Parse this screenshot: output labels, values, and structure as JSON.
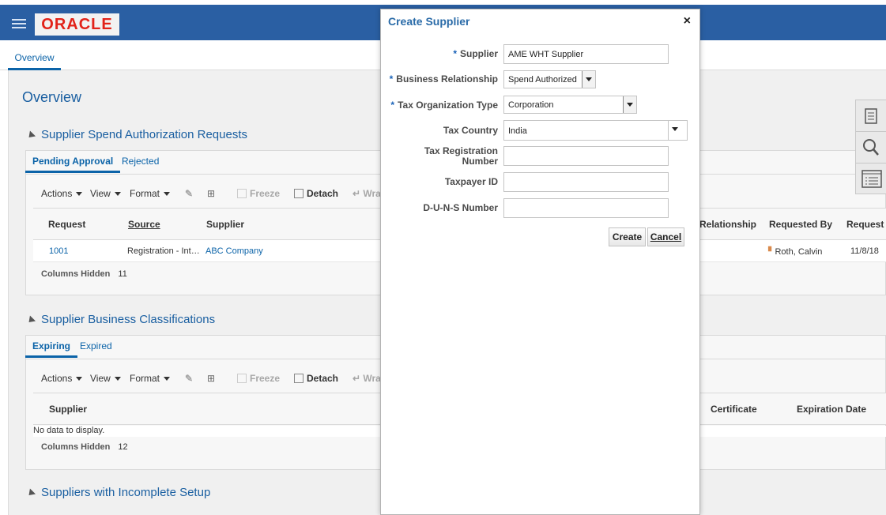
{
  "brand": {
    "logo_text": "ORACLE"
  },
  "nav": {
    "tab_label": "Overview"
  },
  "page": {
    "title": "Overview"
  },
  "section1": {
    "title": "Supplier Spend Authorization Requests",
    "tabs": [
      "Pending Approval",
      "Rejected"
    ],
    "toolbar": {
      "actions": "Actions",
      "view": "View",
      "format": "Format",
      "freeze": "Freeze",
      "detach": "Detach",
      "wrap": "Wra"
    },
    "columns": {
      "request": "Request",
      "source": "Source",
      "supplier": "Supplier",
      "relationship": "Relationship",
      "requested_by": "Requested By",
      "request_date": "Request"
    },
    "row": {
      "request": "1001",
      "source": "Registration - Int…",
      "supplier": "ABC Company",
      "requested_by": "Roth, Calvin",
      "date": "11/8/18"
    },
    "columns_hidden_label": "Columns Hidden",
    "columns_hidden_count": "11"
  },
  "section2": {
    "title": "Supplier Business Classifications",
    "tabs": [
      "Expiring",
      "Expired"
    ],
    "toolbar": {
      "actions": "Actions",
      "view": "View",
      "format": "Format",
      "freeze": "Freeze",
      "detach": "Detach",
      "wrap": "Wra"
    },
    "columns": {
      "supplier": "Supplier",
      "certificate": "Certificate",
      "expiration": "Expiration Date"
    },
    "empty_text": "No data to display.",
    "columns_hidden_label": "Columns Hidden",
    "columns_hidden_count": "12"
  },
  "section3": {
    "title": "Suppliers with Incomplete Setup"
  },
  "dialog": {
    "title": "Create Supplier",
    "close": "×",
    "fields": {
      "supplier_label": "Supplier",
      "supplier_value": "AME WHT Supplier",
      "business_relationship_label": "Business Relationship",
      "business_relationship_value": "Spend Authorized",
      "tax_org_type_label": "Tax Organization Type",
      "tax_org_type_value": "Corporation",
      "tax_country_label": "Tax Country",
      "tax_country_value": "India",
      "tax_reg_label_1": "Tax Registration",
      "tax_reg_label_2": "Number",
      "tax_reg_value": "",
      "taxpayer_id_label": "Taxpayer ID",
      "taxpayer_id_value": "",
      "duns_label": "D-U-N-S Number",
      "duns_value": ""
    },
    "required_mark": "*",
    "buttons": {
      "create": "Create",
      "cancel": "Cancel"
    }
  },
  "colors": {
    "header_blue": "#2a5fa3",
    "link_blue": "#0b63a8",
    "title_blue": "#1a5fa1",
    "oracle_red": "#e2231a"
  }
}
